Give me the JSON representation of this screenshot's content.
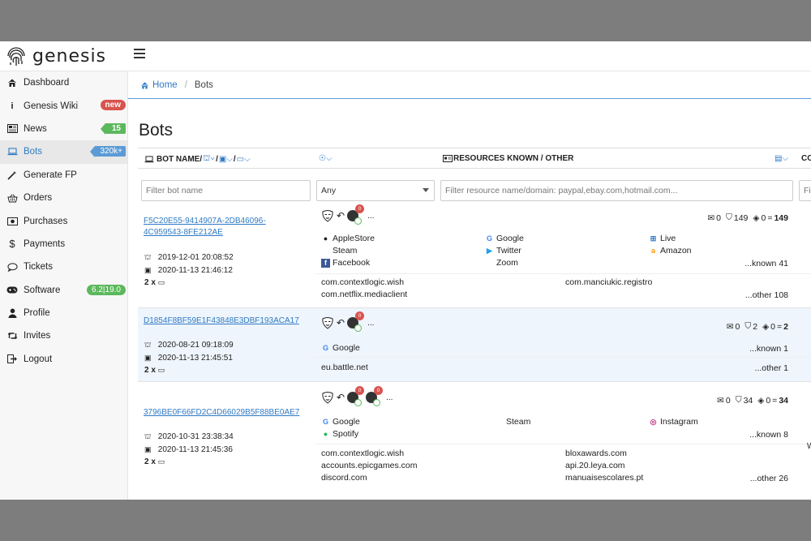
{
  "app": {
    "name": "genesis"
  },
  "sidebar": {
    "items": [
      {
        "label": "Dashboard",
        "icon": "home-icon"
      },
      {
        "label": "Genesis Wiki",
        "icon": "info-icon",
        "badge": "new"
      },
      {
        "label": "News",
        "icon": "newspaper-icon",
        "badge": "15"
      },
      {
        "label": "Bots",
        "icon": "laptop-icon",
        "badge": "320k+"
      },
      {
        "label": "Generate FP",
        "icon": "magic-wand-icon"
      },
      {
        "label": "Orders",
        "icon": "basket-icon"
      },
      {
        "label": "Purchases",
        "icon": "money-icon"
      },
      {
        "label": "Payments",
        "icon": "dollar-icon"
      },
      {
        "label": "Tickets",
        "icon": "comment-icon"
      },
      {
        "label": "Software",
        "icon": "gamepad-icon",
        "badge": "6.2|19.0"
      },
      {
        "label": "Profile",
        "icon": "user-icon"
      },
      {
        "label": "Invites",
        "icon": "retweet-icon"
      },
      {
        "label": "Logout",
        "icon": "sign-out-icon"
      }
    ]
  },
  "breadcrumb": {
    "home": "Home",
    "current": "Bots"
  },
  "page": {
    "title": "Bots"
  },
  "table": {
    "headers": {
      "bot_name": "BOT NAME/",
      "resources": "RESOURCES KNOWN / OTHER",
      "edge": "CO"
    },
    "filters": {
      "bot_name_placeholder": "Filter bot name",
      "select_value": "Any",
      "resource_placeholder": "Filter resource name/domain: paypal,ebay.com,hotmail.com...",
      "edge_placeholder": "Filt"
    },
    "rows": [
      {
        "name_line1": "F5C20E55-9414907A-2DB46096-",
        "name_line2": "4C959543-8FE212AE",
        "created": "2019-12-01 20:08:52",
        "updated": "2020-11-13 21:46:12",
        "devices": "2 x",
        "badges": [
          "0"
        ],
        "counts": {
          "mail": "0",
          "bookmark": "149",
          "diamond": "0",
          "total": "149"
        },
        "known": [
          {
            "name": "AppleStore",
            "icon": "apple-icon"
          },
          {
            "name": "Google",
            "icon": "google-icon"
          },
          {
            "name": "Live",
            "icon": "windows-icon"
          },
          {
            "name": "Steam",
            "icon": ""
          },
          {
            "name": "Twitter",
            "icon": "twitter-icon"
          },
          {
            "name": "Amazon",
            "icon": "amazon-icon"
          },
          {
            "name": "Facebook",
            "icon": "facebook-icon"
          },
          {
            "name": "Zoom",
            "icon": ""
          }
        ],
        "known_more": "...known 41",
        "other": [
          "com.contextlogic.wish",
          "com.manciukic.registro",
          "com.netflix.mediaclient"
        ],
        "other_more": "...other 108",
        "edge_text": ""
      },
      {
        "name_line1": "D1854F8BF59E1F43848E3DBF193ACA17",
        "name_line2": "",
        "created": "2020-08-21 09:18:09",
        "updated": "2020-11-13 21:45:51",
        "devices": "2 x",
        "badges": [
          "0"
        ],
        "counts": {
          "mail": "0",
          "bookmark": "2",
          "diamond": "0",
          "total": "2"
        },
        "known": [
          {
            "name": "Google",
            "icon": "google-icon"
          }
        ],
        "known_more": "...known 1",
        "other": [
          "eu.battle.net"
        ],
        "other_more": "...other 1",
        "edge_text": ""
      },
      {
        "name_line1": "3796BE0F66FD2C4D66029B5F88BE0AE7",
        "name_line2": "",
        "created": "2020-10-31 23:38:34",
        "updated": "2020-11-13 21:45:36",
        "devices": "2 x",
        "badges": [
          "0",
          "0"
        ],
        "counts": {
          "mail": "0",
          "bookmark": "34",
          "diamond": "0",
          "total": "34"
        },
        "known": [
          {
            "name": "Google",
            "icon": "google-icon"
          },
          {
            "name": "Steam",
            "icon": ""
          },
          {
            "name": "Instagram",
            "icon": "instagram-icon"
          },
          {
            "name": "Spotify",
            "icon": "spotify-icon"
          }
        ],
        "known_more": "...known 8",
        "other": [
          "com.contextlogic.wish",
          "bloxawards.com",
          "accounts.epicgames.com",
          "api.20.leya.com",
          "discord.com",
          "manuaisescolares.pt"
        ],
        "other_more": "...other 26",
        "edge_text": "W"
      }
    ]
  },
  "colors": {
    "link": "#2f7ac4",
    "badge_red": "#d9534f",
    "badge_green": "#5cb85c",
    "badge_blue": "#5b9bd5",
    "row_highlight": "#eef5fc"
  }
}
